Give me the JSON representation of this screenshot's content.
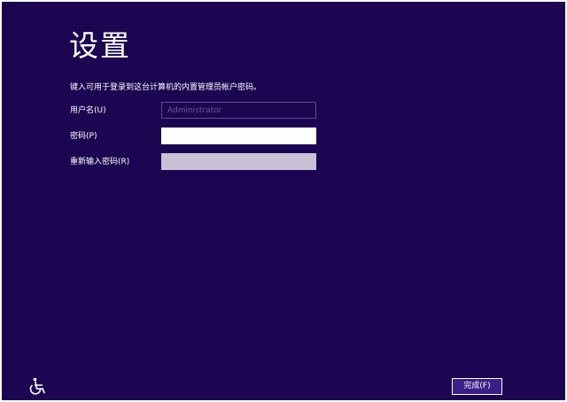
{
  "page": {
    "title": "设置",
    "instruction": "键入可用于登录到这台计算机的内置管理员帐户密码。"
  },
  "form": {
    "username": {
      "label": "用户名(U)",
      "value": "Administrator",
      "enabled": false
    },
    "password": {
      "label": "密码(P)",
      "value": ""
    },
    "reenter_password": {
      "label": "重新输入密码(R)",
      "value": ""
    }
  },
  "footer": {
    "accessibility_icon": "ease-of-access-icon",
    "finish_label": "完成(F)"
  },
  "colors": {
    "background": "#1c0651",
    "button": "#3a1f87",
    "disabled_input_border": "#5e4b8c",
    "reenter_input_fill": "#c8c1d6"
  }
}
